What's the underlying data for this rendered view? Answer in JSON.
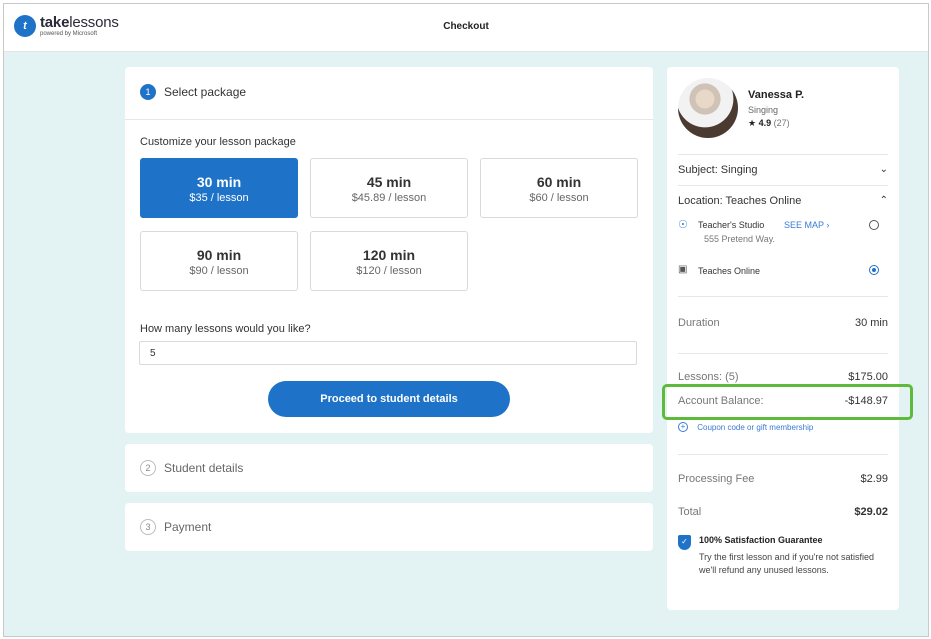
{
  "header": {
    "logo_name_bold": "take",
    "logo_name_thin": "lessons",
    "logo_sub": "powered by Microsoft",
    "title": "Checkout"
  },
  "steps": {
    "step1": {
      "num": "1",
      "label": "Select package"
    },
    "step2": {
      "num": "2",
      "label": "Student details"
    },
    "step3": {
      "num": "3",
      "label": "Payment"
    }
  },
  "package": {
    "customize_label": "Customize your lesson package",
    "options": [
      {
        "duration": "30 min",
        "price": "$35 / lesson",
        "selected": true
      },
      {
        "duration": "45 min",
        "price": "$45.89 / lesson",
        "selected": false
      },
      {
        "duration": "60 min",
        "price": "$60 / lesson",
        "selected": false
      },
      {
        "duration": "90 min",
        "price": "$90 / lesson",
        "selected": false
      },
      {
        "duration": "120 min",
        "price": "$120 / lesson",
        "selected": false
      }
    ],
    "lessons_question": "How many lessons would you like?",
    "lessons_value": "5",
    "proceed_label": "Proceed to student details"
  },
  "teacher": {
    "name": "Vanessa P.",
    "subject": "Singing",
    "rating": "4.9",
    "reviews": "(27)"
  },
  "summary": {
    "subject_label": "Subject: Singing",
    "location_label": "Location: Teaches Online",
    "studio_label": "Teacher's Studio",
    "see_map": "SEE MAP",
    "studio_address": "555 Pretend Way.",
    "online_label": "Teaches Online",
    "duration_label": "Duration",
    "duration_value": "30 min",
    "lessons_label": "Lessons: (5)",
    "lessons_value": "$175.00",
    "balance_label": "Account Balance:",
    "balance_value": "-$148.97",
    "coupon_label": "Coupon code or gift membership",
    "fee_label": "Processing Fee",
    "fee_value": "$2.99",
    "total_label": "Total",
    "total_value": "$29.02",
    "guarantee_title": "100% Satisfaction Guarantee",
    "guarantee_text": "Try the first lesson and if you're not satisfied we'll refund any unused lessons."
  },
  "colors": {
    "accent": "#1e73c8",
    "highlight": "#5dba3b",
    "background": "#e3f3f3"
  }
}
